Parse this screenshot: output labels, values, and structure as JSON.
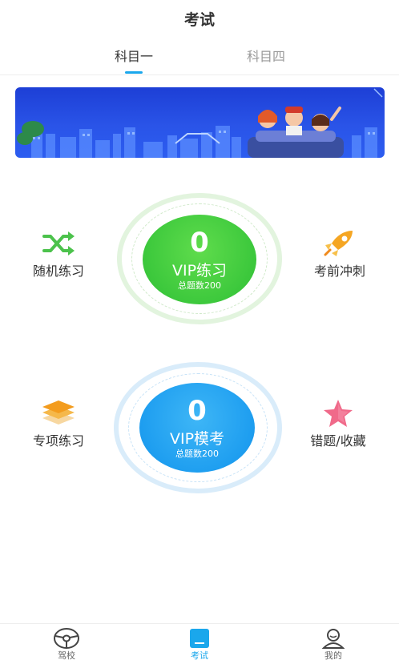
{
  "header": {
    "title": "考试"
  },
  "tabs": [
    {
      "label": "科目一",
      "active": true
    },
    {
      "label": "科目四",
      "active": false
    }
  ],
  "practice": {
    "random_label": "随机练习",
    "sprint_label": "考前冲刺",
    "special_label": "专项练习",
    "wrong_fav_label": "错题/收藏"
  },
  "vip_practice": {
    "count": "0",
    "name": "VIP练习",
    "total": "总题数200"
  },
  "vip_exam": {
    "count": "0",
    "name": "VIP模考",
    "total": "总题数200"
  },
  "tabbar": {
    "school": "驾校",
    "exam": "考试",
    "mine": "我的"
  },
  "colors": {
    "accent": "#1aa7ec",
    "green": "#3cc83c",
    "blue": "#1e9ef0"
  },
  "icons": [
    "shuffle-icon",
    "rocket-icon",
    "layers-icon",
    "star-icon",
    "steering-wheel-icon",
    "exam-paper-icon",
    "user-icon"
  ]
}
